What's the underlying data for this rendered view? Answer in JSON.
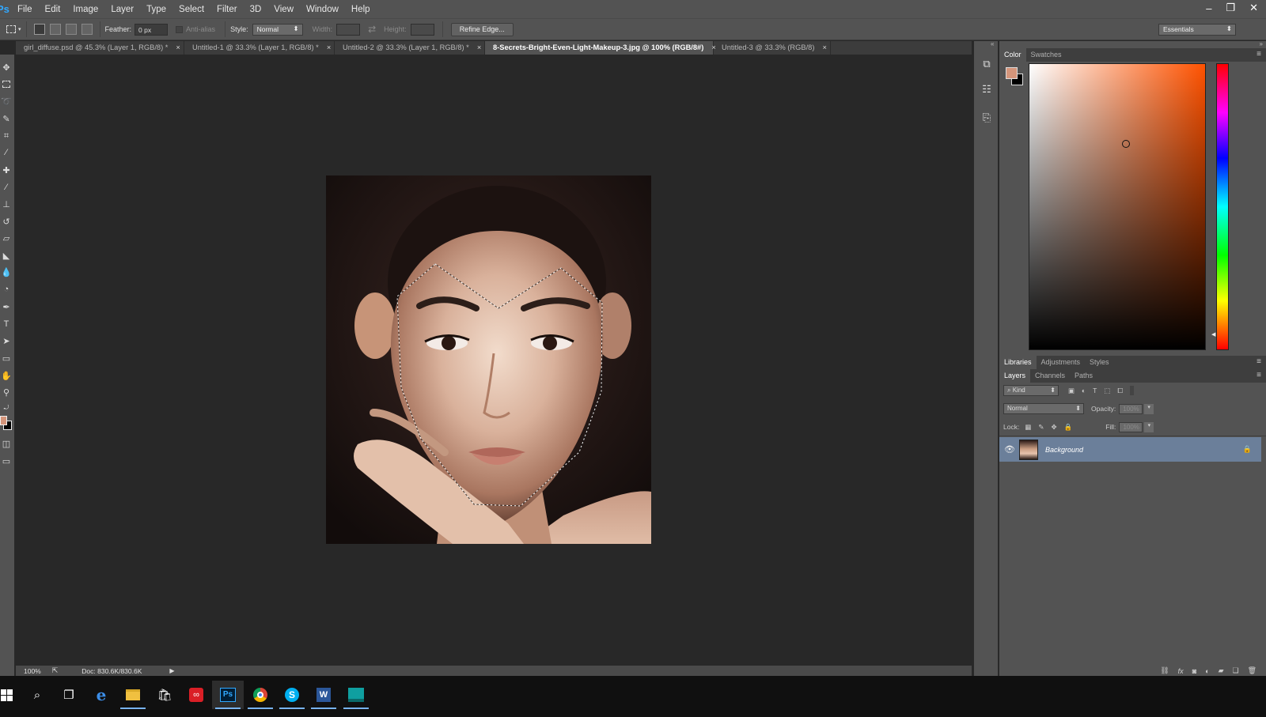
{
  "app": {
    "logo": "Ps"
  },
  "menu": [
    "File",
    "Edit",
    "Image",
    "Layer",
    "Type",
    "Select",
    "Filter",
    "3D",
    "View",
    "Window",
    "Help"
  ],
  "window_controls": {
    "minimize": "–",
    "restore": "❐",
    "close": "✕"
  },
  "options": {
    "feather_label": "Feather:",
    "feather_value": "0 px",
    "antialias_label": "Anti-alias",
    "style_label": "Style:",
    "style_value": "Normal",
    "width_label": "Width:",
    "height_label": "Height:",
    "refine_edge": "Refine Edge...",
    "workspace": "Essentials"
  },
  "tabs": [
    {
      "title": "girl_diffuse.psd @ 45.3% (Layer 1, RGB/8) *",
      "close": "×"
    },
    {
      "title": "Untitled-1 @ 33.3% (Layer 1, RGB/8) *",
      "close": "×"
    },
    {
      "title": "Untitled-2 @ 33.3% (Layer 1, RGB/8) *",
      "close": "×"
    },
    {
      "title": "8-Secrets-Bright-Even-Light-Makeup-3.jpg @ 100% (RGB/8#)",
      "close": "×"
    },
    {
      "title": "Untitled-3 @ 33.3% (RGB/8)",
      "close": "×"
    }
  ],
  "status": {
    "zoom": "100%",
    "doc": "Doc: 830.6K/830.6K"
  },
  "color_panel": {
    "tabs": [
      "Color",
      "Swatches"
    ],
    "foreground": "#d4957b",
    "background": "#000000",
    "hue_base": "#ff5200"
  },
  "libraries_panel": {
    "tabs": [
      "Libraries",
      "Adjustments",
      "Styles"
    ]
  },
  "layers_panel": {
    "tabs": [
      "Layers",
      "Channels",
      "Paths"
    ],
    "filter_kind": "Kind",
    "blend_mode": "Normal",
    "opacity_label": "Opacity:",
    "opacity_value": "100%",
    "lock_label": "Lock:",
    "fill_label": "Fill:",
    "fill_value": "100%",
    "layers": [
      {
        "name": "Background",
        "visible": true,
        "locked": true
      }
    ]
  },
  "taskbar": {
    "apps": [
      "start-icon",
      "search-icon",
      "task-view-icon",
      "edge-icon",
      "file-explorer-icon",
      "store-icon",
      "creative-cloud-icon",
      "photoshop-icon",
      "chrome-icon",
      "skype-icon",
      "word-icon",
      "maps-icon"
    ],
    "ps_label": "Ps",
    "word_label": "W",
    "skype_label": "S"
  }
}
